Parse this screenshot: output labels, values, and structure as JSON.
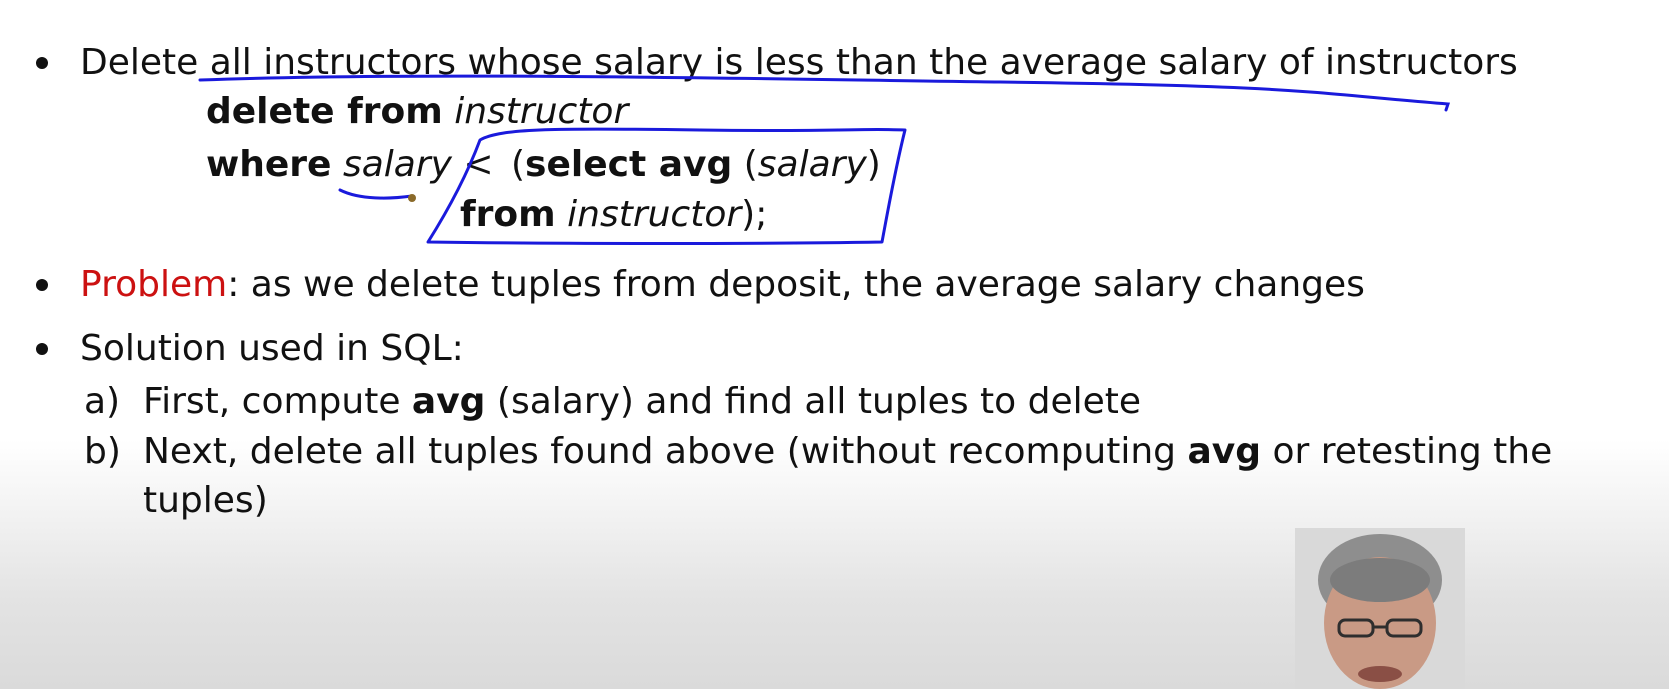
{
  "slide": {
    "bullet1": {
      "prefix": "Delete ",
      "text": "all instructors whose salary is less than the average salary of instructors"
    },
    "sql": {
      "delete_kw": "delete from",
      "delete_table": "instructor",
      "where_kw": "where",
      "where_col": "salary",
      "op": "<",
      "sub_open": "(",
      "select_kw": "select avg",
      "avg_open": "(",
      "avg_col": "salary",
      "avg_close": ")",
      "from_kw": "from",
      "from_table": "instructor",
      "end": ");"
    },
    "bullet2": {
      "label": "Problem",
      "text": ": as we delete tuples from deposit, the average salary changes"
    },
    "bullet3": {
      "text": "Solution used in SQL:"
    },
    "steps": [
      {
        "marker": "a)",
        "before": "First, compute ",
        "kw": "avg",
        "after": " (salary) and find all tuples to delete"
      },
      {
        "marker": "b)",
        "before": "Next, delete all tuples found above (without recomputing ",
        "kw": "avg",
        "after": " or retesting the",
        "cont": "tuples)"
      }
    ]
  },
  "colors": {
    "text": "#111111",
    "problem": "#cc1111",
    "annotation_ink": "#1a1adc"
  }
}
